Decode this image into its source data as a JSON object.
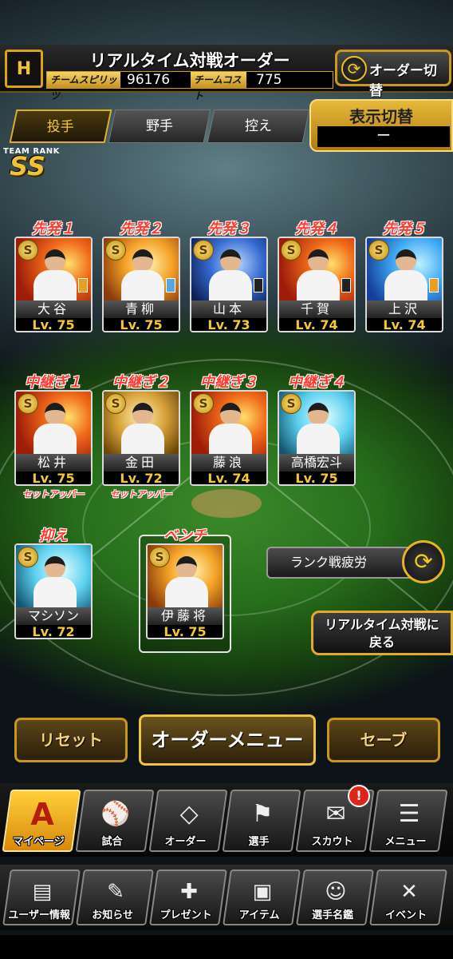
{
  "header": {
    "logo_text": "H",
    "title": "リアルタイム対戦オーダー",
    "spirit_label": "チームスピリッツ",
    "spirit_value": "96176",
    "cost_label": "チームコスト",
    "cost_value": "775",
    "order_switch_label": "オーダー切替"
  },
  "tabs": [
    {
      "label": "投手",
      "active": true
    },
    {
      "label": "野手",
      "active": false
    },
    {
      "label": "控え",
      "active": false
    }
  ],
  "display_switch": {
    "label": "表示切替",
    "value": "ー"
  },
  "team_rank": {
    "label": "TEAM RANK",
    "value": "SS"
  },
  "starters": [
    {
      "role": "先発１",
      "name": "大谷",
      "level": "Lv. 75"
    },
    {
      "role": "先発２",
      "name": "青柳",
      "level": "Lv. 75"
    },
    {
      "role": "先発３",
      "name": "山本",
      "level": "Lv. 73"
    },
    {
      "role": "先発４",
      "name": "千賀",
      "level": "Lv. 74"
    },
    {
      "role": "先発５",
      "name": "上沢",
      "level": "Lv. 74"
    }
  ],
  "relievers": [
    {
      "role": "中継ぎ１",
      "name": "松井",
      "level": "Lv. 75",
      "tag": "セットアッパー"
    },
    {
      "role": "中継ぎ２",
      "name": "金田",
      "level": "Lv. 72",
      "tag": "セットアッパー"
    },
    {
      "role": "中継ぎ３",
      "name": "藤浪",
      "level": "Lv. 74",
      "tag": ""
    },
    {
      "role": "中継ぎ４",
      "name": "高橋宏斗",
      "level": "Lv. 75",
      "tag": ""
    }
  ],
  "closer": {
    "role": "抑え",
    "name": "マシソン",
    "level": "Lv. 72"
  },
  "bench": {
    "role": "ベンチ",
    "name": "伊藤将",
    "level": "Lv. 75"
  },
  "rank_fatigue_label": "ランク戦疲労",
  "return_label_1": "リアルタイム対戦に",
  "return_label_2": "戻る",
  "actions": {
    "reset": "リセット",
    "order_menu": "オーダーメニュー",
    "save": "セーブ"
  },
  "nav_primary": [
    {
      "label": "マイページ",
      "icon": "A"
    },
    {
      "label": "試合",
      "icon": "⚾"
    },
    {
      "label": "オーダー",
      "icon": "◇"
    },
    {
      "label": "選手",
      "icon": "⚑"
    },
    {
      "label": "スカウト",
      "icon": "✉"
    },
    {
      "label": "メニュー",
      "icon": "☰"
    }
  ],
  "nav_secondary": [
    {
      "label": "ユーザー情報",
      "icon": "▤"
    },
    {
      "label": "お知らせ",
      "icon": "✎"
    },
    {
      "label": "プレゼント",
      "icon": "✚"
    },
    {
      "label": "アイテム",
      "icon": "▣"
    },
    {
      "label": "選手名鑑",
      "icon": "☺"
    },
    {
      "label": "イベント",
      "icon": "✕"
    }
  ],
  "alert_badge": "!"
}
